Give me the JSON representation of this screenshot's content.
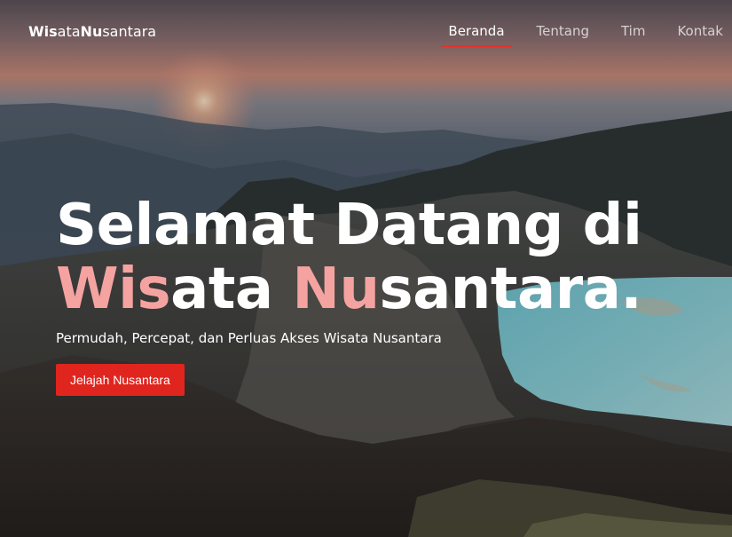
{
  "brand": {
    "part1": "Wis",
    "part2": "ata",
    "part3": "Nu",
    "part4": "santara"
  },
  "nav": {
    "items": [
      {
        "label": "Beranda",
        "active": true
      },
      {
        "label": "Tentang",
        "active": false
      },
      {
        "label": "Tim",
        "active": false
      },
      {
        "label": "Kontak",
        "active": false
      }
    ]
  },
  "hero": {
    "line1": "Selamat Datang di",
    "line2_hl1": "Wis",
    "line2_a": "ata ",
    "line2_hl2": "Nu",
    "line2_b": "santara.",
    "tagline": "Permudah, Percepat, dan Perluas Akses Wisata Nusantara",
    "cta_label": "Jelajah Nusantara"
  },
  "colors": {
    "accent": "#e0251f",
    "highlight": "#f4a3a1",
    "nav_underline": "#e4312b"
  }
}
